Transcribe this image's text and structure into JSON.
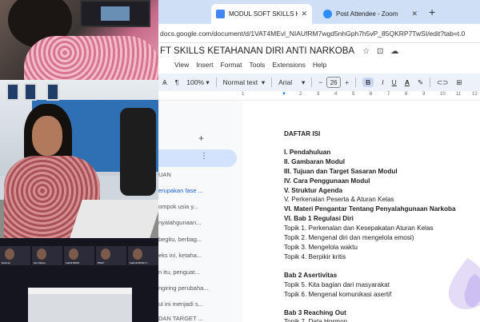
{
  "browser": {
    "tabs": [
      {
        "label": "MODUL SOFT SKILLS KETAHAN",
        "active": true,
        "favicon_color": "#4285f4"
      },
      {
        "label": "Post Attendee - Zoom",
        "active": false,
        "favicon_color": "#2d8cff"
      }
    ],
    "url": "docs.google.com/document/d/1VAT4MEvl_NIAUfRM7wgd5nhGph7h5vP_85QKRP7TwSI/edit?tab=t.0"
  },
  "doc": {
    "title": "FT SKILLS KETAHANAN DIRI ANTI NARKOBA",
    "menu": [
      "View",
      "Insert",
      "Format",
      "Tools",
      "Extensions",
      "Help"
    ],
    "toolbar": {
      "zoom": "100%",
      "style": "Normal text",
      "font": "Arial",
      "size": "26",
      "bold": "B",
      "italic": "I",
      "underline": "U",
      "textcolor": "A"
    },
    "ruler": [
      "1",
      "2",
      "3",
      "4",
      "5",
      "6",
      "7",
      "8",
      "9",
      "10",
      "11",
      "12"
    ],
    "outline": [
      {
        "text": "UAN",
        "blue": false
      },
      {
        "text": "erupakan fase ...",
        "blue": true
      },
      {
        "text": "ompok usia y...",
        "blue": false
      },
      {
        "text": "nyalahgunaan...",
        "blue": false
      },
      {
        "text": "begitu, berbag...",
        "blue": false
      },
      {
        "text": "eks ini, ketaha...",
        "blue": false
      },
      {
        "text": "n itu, penguat...",
        "blue": false
      },
      {
        "text": "ngiring perubaha...",
        "blue": false
      },
      {
        "text": "ul ini menjadi s...",
        "blue": false
      },
      {
        "text": "DAN TARGET ...",
        "blue": false
      }
    ],
    "toc": [
      {
        "text": "DAFTAR ISI",
        "bold": true
      },
      {
        "text": "",
        "bold": false
      },
      {
        "text": "I. Pendahuluan",
        "bold": true
      },
      {
        "text": "II. Gambaran Modul",
        "bold": true
      },
      {
        "text": "III. Tujuan dan Target Sasaran Modul",
        "bold": true
      },
      {
        "text": "IV. Cara Penggunaan Modul",
        "bold": true
      },
      {
        "text": "V. Struktur Agenda",
        "bold": true
      },
      {
        "text": "V. Perkenalan Peserta & Aturan Kelas",
        "bold": false
      },
      {
        "text": "VI. Materi Pengantar Tentang Penyalahgunaan Narkoba",
        "bold": true
      },
      {
        "text": "VI. Bab 1 Regulasi Diri",
        "bold": true
      },
      {
        "text": "Topik 1. Perkenalan dan Kesepakatan Aturan Kelas",
        "bold": false
      },
      {
        "text": "Topik 2. Mengenal diri dan mengelola emosi)",
        "bold": false
      },
      {
        "text": "Topik 3. Mengelola waktu",
        "bold": false
      },
      {
        "text": "Topik 4. Berpikir kritis",
        "bold": false
      },
      {
        "text": "",
        "bold": false
      },
      {
        "text": "Bab 2 Asertivitas",
        "bold": true
      },
      {
        "text": "Topik 5. Kita bagian dari masyarakat",
        "bold": false
      },
      {
        "text": "Topik 6. Mengenal komunikasi asertif",
        "bold": false
      },
      {
        "text": "",
        "bold": false
      },
      {
        "text": "Bab 3 Reaching Out",
        "bold": true
      },
      {
        "text": "Topik 7. Data Hormon",
        "bold": false
      }
    ]
  },
  "video": {
    "gallery": [
      {
        "name": "Rahmat"
      },
      {
        "name": "Dwi Wahyu"
      },
      {
        "name": "Fadhli BNNP"
      },
      {
        "name": "BNNP"
      },
      {
        "name": "Fadhull BNNP K..."
      }
    ]
  }
}
